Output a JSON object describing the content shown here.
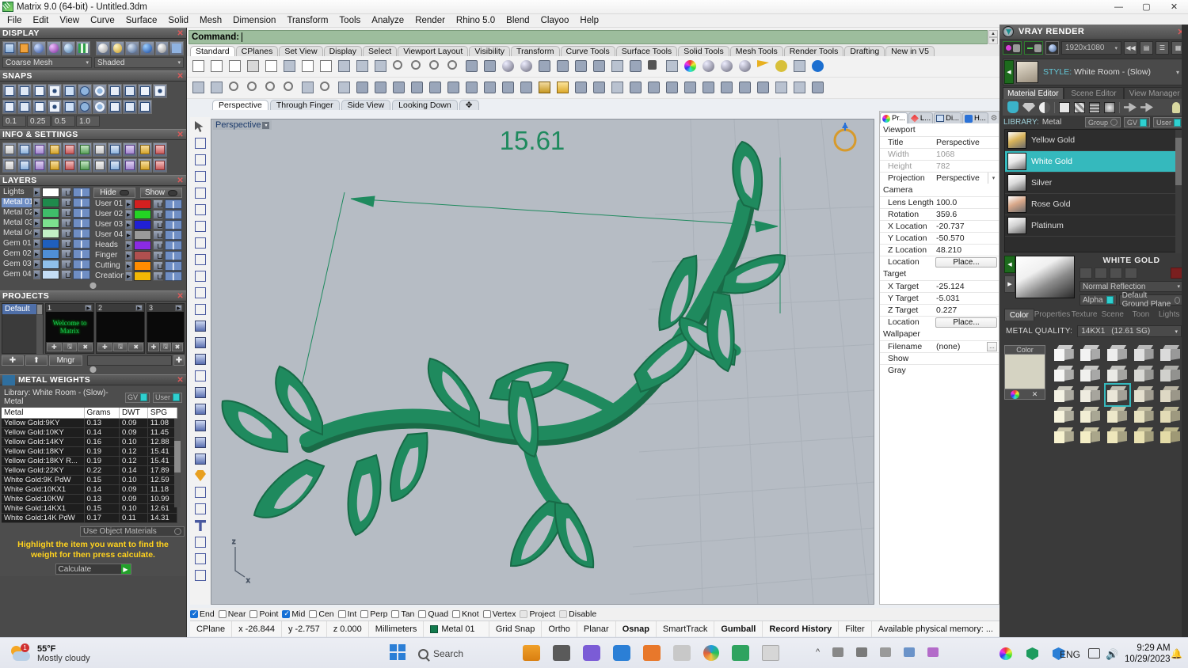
{
  "window": {
    "title": "Matrix 9.0 (64-bit) - Untitled.3dm",
    "minimize": "—",
    "maximize": "▢",
    "close": "✕"
  },
  "menu": [
    "File",
    "Edit",
    "View",
    "Curve",
    "Surface",
    "Solid",
    "Mesh",
    "Dimension",
    "Transform",
    "Tools",
    "Analyze",
    "Render",
    "Rhino 5.0",
    "Blend",
    "Clayoo",
    "Help"
  ],
  "left": {
    "display": {
      "title": "DISPLAY",
      "close": "✕",
      "mesh_combo": "Coarse Mesh",
      "shade_combo": "Shaded",
      "arrow": "▾"
    },
    "snaps": {
      "title": "SNAPS",
      "close": "✕",
      "values": [
        "0.1",
        "0.25",
        "0.5",
        "1.0"
      ]
    },
    "info": {
      "title": "INFO & SETTINGS",
      "close": "✕"
    },
    "layers": {
      "title": "LAYERS",
      "close": "✕",
      "hide_label": "Hide",
      "show_label": "Show",
      "lights_label": "Lights",
      "col_left": [
        {
          "name": "Metal 01",
          "color": "#1f8a4c",
          "selected": true
        },
        {
          "name": "Metal 02",
          "color": "#3fbd6a",
          "selected": false
        },
        {
          "name": "Metal 03",
          "color": "#7ce08f",
          "selected": false
        },
        {
          "name": "Metal 04",
          "color": "#c3f0c6",
          "selected": false
        },
        {
          "name": "Gem 01",
          "color": "#1f5fbd",
          "selected": false
        },
        {
          "name": "Gem 02",
          "color": "#4f8fd6",
          "selected": false
        },
        {
          "name": "Gem 03",
          "color": "#8fc0ea",
          "selected": false
        },
        {
          "name": "Gem 04",
          "color": "#c4ddf4",
          "selected": false
        }
      ],
      "col_right": [
        {
          "name": "User 01",
          "color": "#d42020"
        },
        {
          "name": "User 02",
          "color": "#24d424"
        },
        {
          "name": "User 03",
          "color": "#2020d4"
        },
        {
          "name": "User 04",
          "color": "#9a9a9a"
        },
        {
          "name": "Heads",
          "color": "#8a2be2"
        },
        {
          "name": "Finger",
          "color": "#b0504f"
        },
        {
          "name": "Cutting",
          "color": "#ff8c00"
        },
        {
          "name": "Creation",
          "color": "#f2b705"
        }
      ]
    },
    "projects": {
      "title": "PROJECTS",
      "close": "✕",
      "list": [
        "Default"
      ],
      "slots": [
        {
          "num": "1",
          "caption": "Welcome to Matrix"
        },
        {
          "num": "2",
          "caption": ""
        },
        {
          "num": "3",
          "caption": ""
        }
      ],
      "buttons": {
        "add": "✚",
        "up": "⬆",
        "mngr": "Mngr",
        "plus": "✚",
        "save": "🖫",
        "del": "✖"
      }
    },
    "metal_weights": {
      "title": "METAL WEIGHTS",
      "close": "✕",
      "library_label": "Library: White Room - (Slow)-Metal",
      "gv_label": "GV",
      "user_label": "User",
      "columns": [
        "Metal",
        "Grams",
        "DWT",
        "SPG"
      ],
      "rows": [
        [
          "Yellow Gold:9KY",
          "0.13",
          "0.09",
          "11.08"
        ],
        [
          "Yellow Gold:10KY",
          "0.14",
          "0.09",
          "11.45"
        ],
        [
          "Yellow Gold:14KY",
          "0.16",
          "0.10",
          "12.88"
        ],
        [
          "Yellow Gold:18KY",
          "0.19",
          "0.12",
          "15.41"
        ],
        [
          "Yellow Gold:18KY R...",
          "0.19",
          "0.12",
          "15.41"
        ],
        [
          "Yellow Gold:22KY",
          "0.22",
          "0.14",
          "17.89"
        ],
        [
          "White Gold:9K PdW",
          "0.15",
          "0.10",
          "12.59"
        ],
        [
          "White Gold:10KX1",
          "0.14",
          "0.09",
          "11.18"
        ],
        [
          "White Gold:10KW",
          "0.13",
          "0.09",
          "10.99"
        ],
        [
          "White Gold:14KX1",
          "0.15",
          "0.10",
          "12.61"
        ],
        [
          "White Gold:14K PdW",
          "0.17",
          "0.11",
          "14.31"
        ]
      ],
      "use_object_materials": "Use Object Materials",
      "warning": "Highlight the item you want to find the weight for then press calculate.",
      "calculate": "Calculate"
    }
  },
  "center": {
    "command": {
      "label": "Command:",
      "value": ""
    },
    "toolbar_tabs": [
      "Standard",
      "CPlanes",
      "Set View",
      "Display",
      "Select",
      "Viewport Layout",
      "Visibility",
      "Transform",
      "Curve Tools",
      "Surface Tools",
      "Solid Tools",
      "Mesh Tools",
      "Render Tools",
      "Drafting",
      "New in V5"
    ],
    "active_toolbar_tab": "Standard",
    "view_tabs": [
      "Perspective",
      "Through Finger",
      "Side View",
      "Looking Down"
    ],
    "active_view_tab": "Perspective",
    "viewport_label": "Perspective",
    "dimension_text": "15.61",
    "axis_labels": {
      "z": "z",
      "x": "x"
    },
    "osnap": [
      {
        "label": "End",
        "on": true
      },
      {
        "label": "Near",
        "on": false
      },
      {
        "label": "Point",
        "on": false
      },
      {
        "label": "Mid",
        "on": true
      },
      {
        "label": "Cen",
        "on": false
      },
      {
        "label": "Int",
        "on": false
      },
      {
        "label": "Perp",
        "on": false
      },
      {
        "label": "Tan",
        "on": false
      },
      {
        "label": "Quad",
        "on": false
      },
      {
        "label": "Knot",
        "on": false
      },
      {
        "label": "Vertex",
        "on": false
      },
      {
        "label": "Project",
        "on": false,
        "gray": true
      },
      {
        "label": "Disable",
        "on": false,
        "gray": true
      }
    ],
    "status": {
      "cplane": "CPlane",
      "x": "x -26.844",
      "y": "y -2.757",
      "z": "z 0.000",
      "units": "Millimeters",
      "layer": "Metal 01",
      "layer_color": "#127a4d",
      "toggles": [
        "Grid Snap",
        "Ortho",
        "Planar",
        "Osnap",
        "SmartTrack",
        "Gumball",
        "Record History",
        "Filter"
      ],
      "memory": "Available physical memory: ..."
    }
  },
  "properties": {
    "tabs": [
      {
        "label": "Pr...",
        "icon": "color-wheel-icon",
        "active": true
      },
      {
        "label": "L...",
        "icon": "layers-icon",
        "active": false
      },
      {
        "label": "Di...",
        "icon": "display-icon",
        "active": false
      },
      {
        "label": "H...",
        "icon": "help-icon",
        "active": false
      }
    ],
    "gear": "⚙",
    "sections": [
      {
        "name": "Viewport",
        "rows": [
          {
            "key": "Title",
            "value": "Perspective",
            "dim": false
          },
          {
            "key": "Width",
            "value": "1068",
            "dim": true
          },
          {
            "key": "Height",
            "value": "782",
            "dim": true
          },
          {
            "key": "Projection",
            "value": "Perspective",
            "dim": false,
            "dropdown": true
          }
        ]
      },
      {
        "name": "Camera",
        "rows": [
          {
            "key": "Lens Length",
            "value": "100.0"
          },
          {
            "key": "Rotation",
            "value": "359.6"
          },
          {
            "key": "X Location",
            "value": "-20.737"
          },
          {
            "key": "Y Location",
            "value": "-50.570"
          },
          {
            "key": "Z Location",
            "value": "48.210"
          },
          {
            "key": "Location",
            "button": "Place..."
          }
        ]
      },
      {
        "name": "Target",
        "rows": [
          {
            "key": "X Target",
            "value": "-25.124"
          },
          {
            "key": "Y Target",
            "value": "-5.031"
          },
          {
            "key": "Z Target",
            "value": "0.227"
          },
          {
            "key": "Location",
            "button": "Place..."
          }
        ]
      },
      {
        "name": "Wallpaper",
        "rows": [
          {
            "key": "Filename",
            "value": "(none)",
            "ellipsis": "..."
          },
          {
            "key": "Show",
            "check": true
          },
          {
            "key": "Gray",
            "check": true
          }
        ]
      }
    ]
  },
  "vray": {
    "title": "VRAY RENDER",
    "close": "✕",
    "resolution": "1920x1080",
    "rewind_icon": "◀◀",
    "style": {
      "label": "STYLE:",
      "value": "White Room - (Slow)",
      "arrow": "▾"
    },
    "tabs": [
      {
        "label": "Material Editor",
        "active": true
      },
      {
        "label": "Scene Editor",
        "active": false
      },
      {
        "label": "View Manager",
        "active": false
      }
    ],
    "library_label": "LIBRARY:",
    "library_value": "Metal",
    "group_label": "Group",
    "gv_label": "GV",
    "user_label": "User",
    "materials": [
      {
        "name": "Yellow Gold",
        "selected": false,
        "swatch": "#d9b45a"
      },
      {
        "name": "White Gold",
        "selected": true,
        "swatch": "#e8e8e8"
      },
      {
        "name": "Silver",
        "selected": false,
        "swatch": "#dcdcdc"
      },
      {
        "name": "Rose Gold",
        "selected": false,
        "swatch": "#d9a88a"
      },
      {
        "name": "Platinum",
        "selected": false,
        "swatch": "#d2d2d2"
      }
    ],
    "current_material": "WHITE GOLD",
    "reflection": "Normal Reflection",
    "alpha_label": "Alpha",
    "ground_plane": "Default Ground Plane",
    "color_tabs": [
      {
        "label": "Color",
        "active": true
      },
      {
        "label": "Properties",
        "active": false
      },
      {
        "label": "Texture",
        "active": false
      },
      {
        "label": "Scene",
        "active": false
      },
      {
        "label": "Toon",
        "active": false
      },
      {
        "label": "Lights",
        "active": false
      }
    ],
    "metal_quality_label": "METAL QUALITY:",
    "metal_quality_value": "14KX1",
    "metal_quality_sg": "(12.61 SG)",
    "color_panel_label": "Color",
    "color_panel_value": "#d5d3c2",
    "color_wheel_icon": "color-wheel-icon",
    "color_clear_icon": "✕",
    "swatch_grid": {
      "rows": 5,
      "cols": 5,
      "selected_index": 12,
      "tints": [
        [
          "#f7f7f7",
          "#f2f2f2",
          "#ededed",
          "#e0e0e0",
          "#dadada"
        ],
        [
          "#f5f5f3",
          "#f0f0ee",
          "#eaeae6",
          "#d8d8d4",
          "#d0d0cc"
        ],
        [
          "#f4f2e4",
          "#efece0",
          "#eae6d8",
          "#e4dfce",
          "#ded8c4"
        ],
        [
          "#f6f3dd",
          "#f2eed4",
          "#ede8ca",
          "#e8e2c0",
          "#e2dbb6"
        ],
        [
          "#f7f2cf",
          "#f3edc5",
          "#eee7bb",
          "#e9e1b1",
          "#e3dba7"
        ]
      ],
      "accent": "#35b9bd"
    }
  },
  "taskbar": {
    "weather_temp": "55°F",
    "weather_desc": "Mostly cloudy",
    "search_placeholder": "Search",
    "language": "ENG",
    "time": "9:29 AM",
    "date": "10/29/2023"
  }
}
